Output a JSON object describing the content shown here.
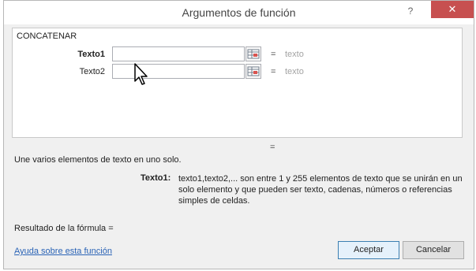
{
  "dialog": {
    "title": "Argumentos de función",
    "help_glyph": "?",
    "close_glyph": "✕"
  },
  "function_name": "CONCATENAR",
  "args": [
    {
      "label": "Texto1",
      "value": "",
      "result": "texto",
      "equals": "="
    },
    {
      "label": "Texto2",
      "value": "",
      "result": "texto",
      "equals": "="
    }
  ],
  "overall_equals": "=",
  "description": "Une varios elementos de texto en uno solo.",
  "arg_help": {
    "label": "Texto1:",
    "text": "texto1,texto2,... son entre 1 y 255 elementos de texto que se unirán en un solo elemento y que pueden ser texto, cadenas, números o referencias simples de celdas."
  },
  "formula_result": "Resultado de la fórmula =",
  "help_link": "Ayuda sobre esta función",
  "buttons": {
    "accept": "Aceptar",
    "cancel": "Cancelar"
  },
  "colors": {
    "accent": "#2a63b6",
    "close": "#c75050"
  }
}
